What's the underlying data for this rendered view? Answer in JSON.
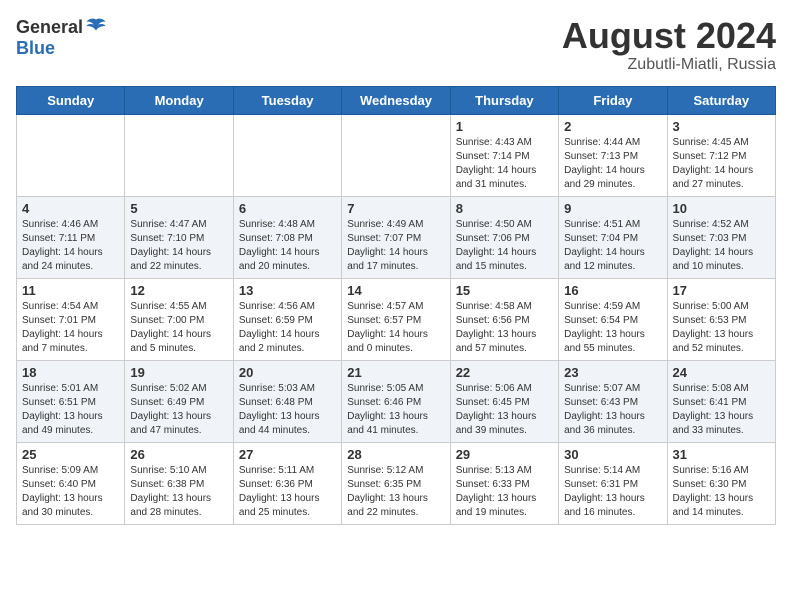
{
  "header": {
    "logo_general": "General",
    "logo_blue": "Blue",
    "month_year": "August 2024",
    "location": "Zubutli-Miatli, Russia"
  },
  "weekdays": [
    "Sunday",
    "Monday",
    "Tuesday",
    "Wednesday",
    "Thursday",
    "Friday",
    "Saturday"
  ],
  "weeks": [
    [
      {
        "day": "",
        "info": ""
      },
      {
        "day": "",
        "info": ""
      },
      {
        "day": "",
        "info": ""
      },
      {
        "day": "",
        "info": ""
      },
      {
        "day": "1",
        "info": "Sunrise: 4:43 AM\nSunset: 7:14 PM\nDaylight: 14 hours\nand 31 minutes."
      },
      {
        "day": "2",
        "info": "Sunrise: 4:44 AM\nSunset: 7:13 PM\nDaylight: 14 hours\nand 29 minutes."
      },
      {
        "day": "3",
        "info": "Sunrise: 4:45 AM\nSunset: 7:12 PM\nDaylight: 14 hours\nand 27 minutes."
      }
    ],
    [
      {
        "day": "4",
        "info": "Sunrise: 4:46 AM\nSunset: 7:11 PM\nDaylight: 14 hours\nand 24 minutes."
      },
      {
        "day": "5",
        "info": "Sunrise: 4:47 AM\nSunset: 7:10 PM\nDaylight: 14 hours\nand 22 minutes."
      },
      {
        "day": "6",
        "info": "Sunrise: 4:48 AM\nSunset: 7:08 PM\nDaylight: 14 hours\nand 20 minutes."
      },
      {
        "day": "7",
        "info": "Sunrise: 4:49 AM\nSunset: 7:07 PM\nDaylight: 14 hours\nand 17 minutes."
      },
      {
        "day": "8",
        "info": "Sunrise: 4:50 AM\nSunset: 7:06 PM\nDaylight: 14 hours\nand 15 minutes."
      },
      {
        "day": "9",
        "info": "Sunrise: 4:51 AM\nSunset: 7:04 PM\nDaylight: 14 hours\nand 12 minutes."
      },
      {
        "day": "10",
        "info": "Sunrise: 4:52 AM\nSunset: 7:03 PM\nDaylight: 14 hours\nand 10 minutes."
      }
    ],
    [
      {
        "day": "11",
        "info": "Sunrise: 4:54 AM\nSunset: 7:01 PM\nDaylight: 14 hours\nand 7 minutes."
      },
      {
        "day": "12",
        "info": "Sunrise: 4:55 AM\nSunset: 7:00 PM\nDaylight: 14 hours\nand 5 minutes."
      },
      {
        "day": "13",
        "info": "Sunrise: 4:56 AM\nSunset: 6:59 PM\nDaylight: 14 hours\nand 2 minutes."
      },
      {
        "day": "14",
        "info": "Sunrise: 4:57 AM\nSunset: 6:57 PM\nDaylight: 14 hours\nand 0 minutes."
      },
      {
        "day": "15",
        "info": "Sunrise: 4:58 AM\nSunset: 6:56 PM\nDaylight: 13 hours\nand 57 minutes."
      },
      {
        "day": "16",
        "info": "Sunrise: 4:59 AM\nSunset: 6:54 PM\nDaylight: 13 hours\nand 55 minutes."
      },
      {
        "day": "17",
        "info": "Sunrise: 5:00 AM\nSunset: 6:53 PM\nDaylight: 13 hours\nand 52 minutes."
      }
    ],
    [
      {
        "day": "18",
        "info": "Sunrise: 5:01 AM\nSunset: 6:51 PM\nDaylight: 13 hours\nand 49 minutes."
      },
      {
        "day": "19",
        "info": "Sunrise: 5:02 AM\nSunset: 6:49 PM\nDaylight: 13 hours\nand 47 minutes."
      },
      {
        "day": "20",
        "info": "Sunrise: 5:03 AM\nSunset: 6:48 PM\nDaylight: 13 hours\nand 44 minutes."
      },
      {
        "day": "21",
        "info": "Sunrise: 5:05 AM\nSunset: 6:46 PM\nDaylight: 13 hours\nand 41 minutes."
      },
      {
        "day": "22",
        "info": "Sunrise: 5:06 AM\nSunset: 6:45 PM\nDaylight: 13 hours\nand 39 minutes."
      },
      {
        "day": "23",
        "info": "Sunrise: 5:07 AM\nSunset: 6:43 PM\nDaylight: 13 hours\nand 36 minutes."
      },
      {
        "day": "24",
        "info": "Sunrise: 5:08 AM\nSunset: 6:41 PM\nDaylight: 13 hours\nand 33 minutes."
      }
    ],
    [
      {
        "day": "25",
        "info": "Sunrise: 5:09 AM\nSunset: 6:40 PM\nDaylight: 13 hours\nand 30 minutes."
      },
      {
        "day": "26",
        "info": "Sunrise: 5:10 AM\nSunset: 6:38 PM\nDaylight: 13 hours\nand 28 minutes."
      },
      {
        "day": "27",
        "info": "Sunrise: 5:11 AM\nSunset: 6:36 PM\nDaylight: 13 hours\nand 25 minutes."
      },
      {
        "day": "28",
        "info": "Sunrise: 5:12 AM\nSunset: 6:35 PM\nDaylight: 13 hours\nand 22 minutes."
      },
      {
        "day": "29",
        "info": "Sunrise: 5:13 AM\nSunset: 6:33 PM\nDaylight: 13 hours\nand 19 minutes."
      },
      {
        "day": "30",
        "info": "Sunrise: 5:14 AM\nSunset: 6:31 PM\nDaylight: 13 hours\nand 16 minutes."
      },
      {
        "day": "31",
        "info": "Sunrise: 5:16 AM\nSunset: 6:30 PM\nDaylight: 13 hours\nand 14 minutes."
      }
    ]
  ]
}
